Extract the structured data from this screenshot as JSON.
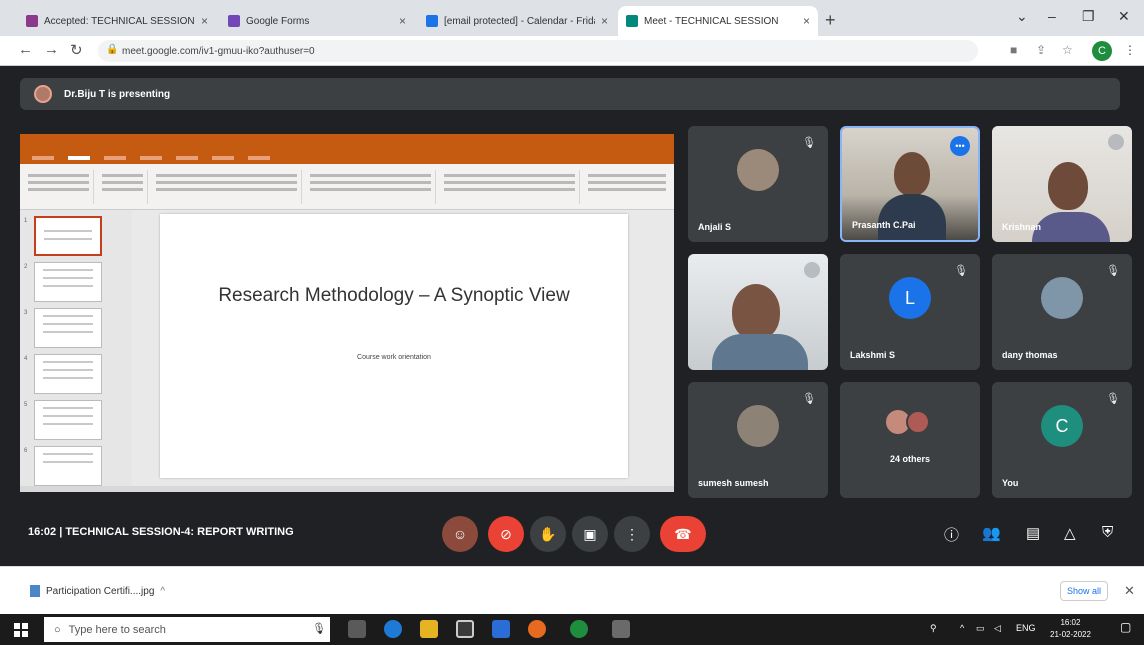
{
  "browser": {
    "tabs": [
      {
        "title": "Accepted: TECHNICAL SESSION",
        "favicon_color": "#8b3a8b"
      },
      {
        "title": "Google Forms",
        "favicon_color": "#7248b9"
      },
      {
        "title": "[email protected] - Calendar - Frida",
        "favicon_color": "#1a73e8"
      },
      {
        "title": "Meet - TECHNICAL SESSION",
        "favicon_color": "#00897b"
      }
    ],
    "url": "meet.google.com/iv1-gmuu-iko?authuser=0"
  },
  "meet": {
    "presenter_text": "Dr.Biju T is presenting",
    "slide": {
      "title": "Research Methodology – A Synoptic View",
      "subtitle": "Course work orientation"
    },
    "participants": [
      {
        "name": "Anjali S",
        "type": "photo"
      },
      {
        "name": "Prasanth C.Pai",
        "type": "video",
        "speaking": true
      },
      {
        "name": "Krishnan",
        "type": "video"
      },
      {
        "name": "",
        "type": "video"
      },
      {
        "name": "Lakshmi S",
        "type": "initial",
        "initial": "L",
        "color": "#1a73e8"
      },
      {
        "name": "dany thomas",
        "type": "photo"
      },
      {
        "name": "sumesh sumesh",
        "type": "photo"
      },
      {
        "name": "24 others",
        "type": "group"
      },
      {
        "name": "You",
        "type": "initial",
        "initial": "C",
        "color": "#1e8e7e"
      }
    ],
    "meeting_info": "16:02 | TECHNICAL SESSION-4: REPORT WRITING"
  },
  "downloads": {
    "file": "Participation Certifi....jpg",
    "show_all": "Show all"
  },
  "taskbar": {
    "search_placeholder": "Type here to search",
    "time": "16:02",
    "date": "21-02-2022",
    "lang": "ENG"
  }
}
